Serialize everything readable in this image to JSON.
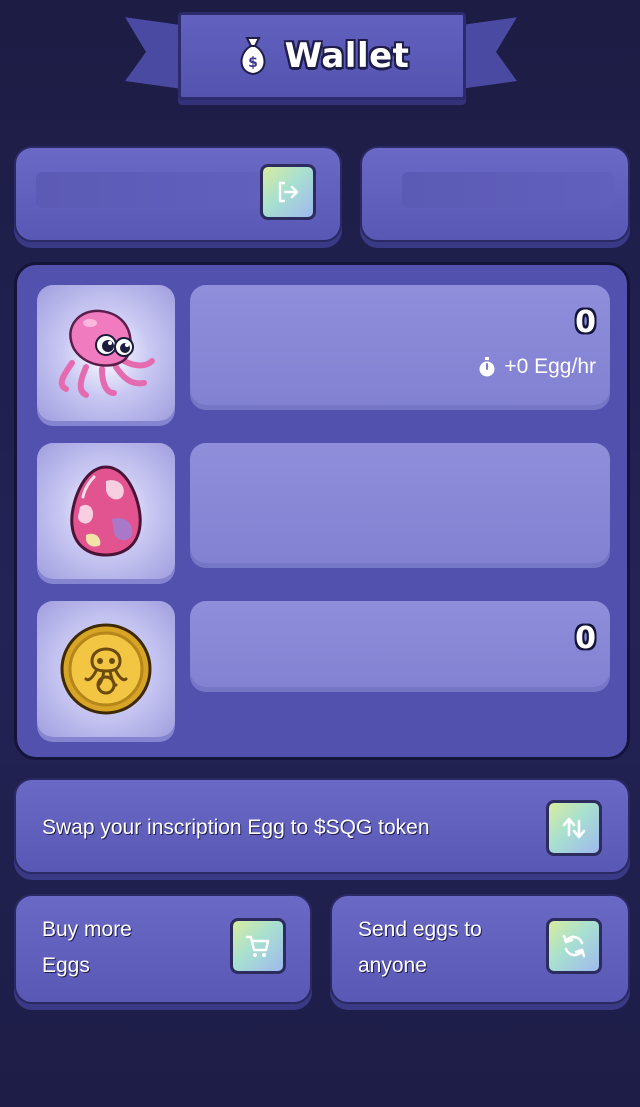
{
  "header": {
    "title": "Wallet",
    "icon": "money-bag-icon"
  },
  "top_cards": {
    "left": {
      "value": "",
      "button_icon": "logout-icon"
    },
    "right": {
      "value": ""
    }
  },
  "assets": [
    {
      "name": "squid",
      "icon": "squid-icon",
      "value": "0",
      "rate": "+0 Egg/hr",
      "rate_icon": "stopwatch-icon"
    },
    {
      "name": "egg",
      "icon": "egg-icon",
      "value": ""
    },
    {
      "name": "coin",
      "icon": "sqg-coin-icon",
      "value": "0"
    }
  ],
  "actions": {
    "swap": {
      "label": "Swap your inscription Egg to $SQG token",
      "icon": "swap-arrows-icon"
    },
    "buy": {
      "line1": "Buy more",
      "line2": "Eggs",
      "icon": "cart-icon"
    },
    "send": {
      "line1": "Send eggs to",
      "line2": "anyone",
      "icon": "refresh-icon"
    }
  },
  "colors": {
    "background": "#1f1f4c",
    "card": "#6362c0",
    "panel": "#5251ad",
    "value_box": "#8887d5",
    "button_gradient_start": "#d8ec9e",
    "button_gradient_end": "#9fb9ee"
  }
}
